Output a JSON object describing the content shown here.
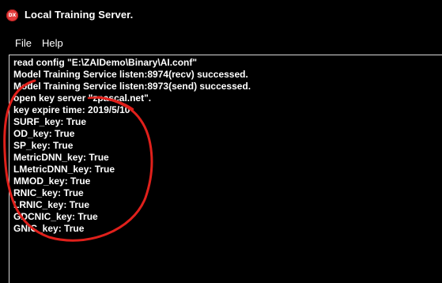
{
  "window": {
    "title": "Local Training Server.",
    "icon": "dx-app-icon",
    "icon_label": "DX",
    "icon_color": "#e23b3b"
  },
  "menu": {
    "items": [
      {
        "label": "File"
      },
      {
        "label": "Help"
      }
    ]
  },
  "log": {
    "lines": [
      "read config \"E:\\ZAIDemo\\Binary\\AI.conf\"",
      "Model Training Service listen:8974(recv) successed.",
      "Model Training Service listen:8973(send) successed.",
      "open key server \"zpascal.net\".",
      "key expire time: 2019/5/10",
      "SURF_key: True",
      "OD_key: True",
      "SP_key: True",
      "MetricDNN_key: True",
      "LMetricDNN_key: True",
      "MMOD_key: True",
      "RNIC_key: True",
      "LRNIC_key: True",
      "GDCNIC_key: True",
      "GNIC_key: True"
    ]
  },
  "colors": {
    "background": "#000000",
    "text": "#ffffff",
    "annotation": "#e0201b"
  }
}
